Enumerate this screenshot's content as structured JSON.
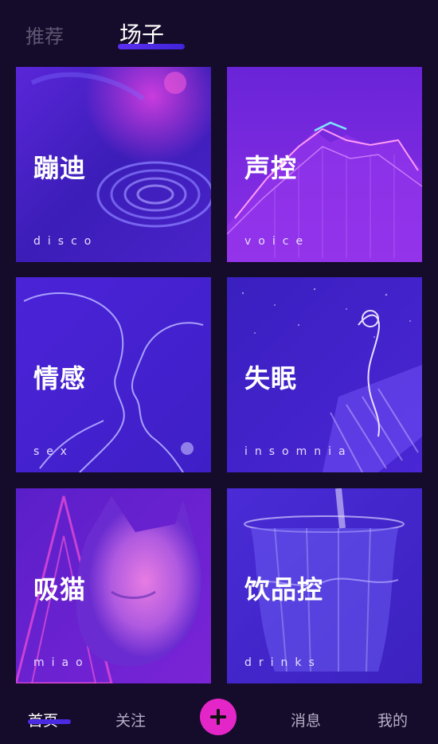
{
  "top_tabs": [
    {
      "label": "推荐",
      "active": false
    },
    {
      "label": "场子",
      "active": true
    }
  ],
  "cards": [
    {
      "title": "蹦迪",
      "subtitle": "disco",
      "icon": "disco-image"
    },
    {
      "title": "声控",
      "subtitle": "voice",
      "icon": "voice-wave-image"
    },
    {
      "title": "情感",
      "subtitle": "sex",
      "icon": "couple-kiss-image"
    },
    {
      "title": "失眠",
      "subtitle": "insomnia",
      "icon": "insomnia-image"
    },
    {
      "title": "吸猫",
      "subtitle": "miao",
      "icon": "cat-image"
    },
    {
      "title": "饮品控",
      "subtitle": "drinks",
      "icon": "drink-image"
    }
  ],
  "bottom_nav": {
    "home": "首页",
    "follow": "关注",
    "add_icon": "plus-icon",
    "messages": "消息",
    "me": "我的"
  },
  "colors": {
    "background": "#150b2a",
    "accent": "#4b2be2",
    "add_button": "#e426c8",
    "card_primary": "#4a1fd6",
    "card_highlight": "#b04cff"
  }
}
